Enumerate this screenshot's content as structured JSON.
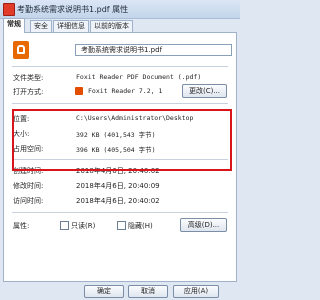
{
  "window": {
    "title": "考勤系统需求说明书1.pdf 属性"
  },
  "tabs": [
    {
      "label": "常规"
    },
    {
      "label": "安全"
    },
    {
      "label": "详细信息"
    },
    {
      "label": "以前的版本"
    }
  ],
  "general": {
    "filename": "考勤系统需求说明书1.pdf",
    "file_type_label": "文件类型:",
    "file_type_value": "Foxit Reader PDF Document (.pdf)",
    "open_with_label": "打开方式:",
    "open_with_value": "Foxit Reader 7.2, 1",
    "change_button": "更改(C)...",
    "location_label": "位置:",
    "location_value": "C:\\Users\\Administrator\\Desktop",
    "size_label": "大小:",
    "size_value": "392 KB (401,543 字节)",
    "size_on_disk_label": "占用空间:",
    "size_on_disk_value": "396 KB (405,504 字节)",
    "created_label": "创建时间:",
    "created_value": "2018年4月6日, 20:40:02",
    "modified_label": "修改时间:",
    "modified_value": "2018年4月6日, 20:40:09",
    "accessed_label": "访问时间:",
    "accessed_value": "2018年4月6日, 20:40:02",
    "attributes_label": "属性:",
    "readonly_label": "只读(R)",
    "hidden_label": "隐藏(H)",
    "advanced_button": "高级(D)..."
  },
  "footer": {
    "ok": "确定",
    "cancel": "取消",
    "apply": "应用(A)"
  },
  "colors": {
    "highlight": "#d9141b",
    "pdf_icon": "#e66a00"
  }
}
